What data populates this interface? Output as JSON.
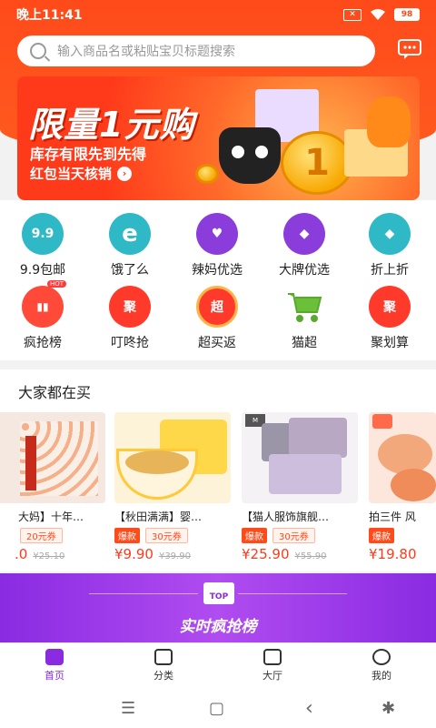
{
  "status": {
    "time": "晚上11:41",
    "battery": "98"
  },
  "search": {
    "placeholder": "输入商品名或粘贴宝贝标题搜索"
  },
  "banner": {
    "title": "限量1元购",
    "line1": "库存有限先到先得",
    "line2": "红包当天核销",
    "coin_text": "1"
  },
  "grid": [
    {
      "label": "9.9包邮",
      "icon_text": "9.9",
      "color": "#2fb8c6",
      "icon": "nine-nine-icon"
    },
    {
      "label": "饿了么",
      "icon_text": "e",
      "color": "#2fb8c6",
      "icon": "eleme-icon"
    },
    {
      "label": "辣妈优选",
      "icon_text": "♥",
      "color": "#8b3ddc",
      "icon": "pacifier-icon"
    },
    {
      "label": "大牌优选",
      "icon_text": "◆",
      "color": "#8b3ddc",
      "icon": "tag-icon"
    },
    {
      "label": "折上折",
      "icon_text": "◆",
      "color": "#2fb8c6",
      "icon": "discount-tag-icon"
    },
    {
      "label": "疯抢榜",
      "icon_text": "▮▮",
      "color": "#ff4a3a",
      "icon": "chart-hot-icon",
      "badge": "HOT"
    },
    {
      "label": "叮咚抢",
      "icon_text": "聚",
      "color": "#ff3a2a",
      "icon": "ju-icon"
    },
    {
      "label": "超买返",
      "icon_text": "超",
      "color": "#ff3a2a",
      "icon": "chao-icon"
    },
    {
      "label": "猫超",
      "icon_text": "🛒",
      "color": "#6bc03a",
      "icon": "cart-icon"
    },
    {
      "label": "聚划算",
      "icon_text": "聚",
      "color": "#ff3a2a",
      "icon": "juhuasuan-icon"
    }
  ],
  "buying": {
    "title": "大家都在买",
    "products": [
      {
        "name": "大妈】十年…",
        "hot": "",
        "coupon": "20元券",
        "price": ".0",
        "old": "¥25.10",
        "img_color": "#f4e8e0"
      },
      {
        "name": "【秋田满满】婴…",
        "hot": "爆款",
        "coupon": "30元券",
        "price": "¥9.90",
        "old": "¥39.90",
        "img_color": "#fdf3d8"
      },
      {
        "name": "【猫人服饰旗舰…",
        "hot": "爆款",
        "coupon": "30元券",
        "price": "¥25.90",
        "old": "¥55.90",
        "img_color": "#ece8ee"
      },
      {
        "name": "拍三件 风",
        "hot": "爆款",
        "coupon": "",
        "price": "¥19.80",
        "old": "",
        "img_color": "#fde7dc"
      }
    ]
  },
  "ranking": {
    "badge": "TOP",
    "title": "实时疯抢榜"
  },
  "tabs": [
    {
      "label": "首页",
      "active": true
    },
    {
      "label": "分类",
      "active": false
    },
    {
      "label": "大厅",
      "active": false
    },
    {
      "label": "我的",
      "active": false
    }
  ],
  "sysnav": {
    "menu": "☰",
    "home": "▢",
    "back": "‹",
    "access": "✱"
  }
}
